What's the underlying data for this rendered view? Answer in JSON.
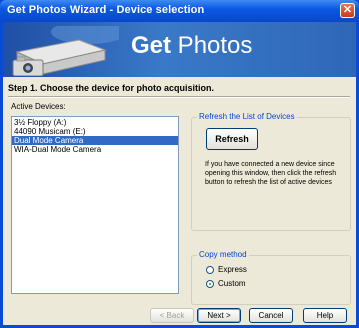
{
  "window": {
    "title": "Get Photos Wizard - Device selection",
    "close_glyph": "✕"
  },
  "banner": {
    "title_bold": "Get",
    "title_rest": " Photos",
    "logo_icon": "scanner-camera-icon"
  },
  "step": {
    "text": "Step 1. Choose the device for photo acquisition."
  },
  "devices": {
    "label": "Active Devices:",
    "items": [
      {
        "label": "3½ Floppy (A:)",
        "selected": false
      },
      {
        "label": "44090 Musicam (E:)",
        "selected": false
      },
      {
        "label": "Dual Mode Camera",
        "selected": true
      },
      {
        "label": "WIA-Dual Mode Camera",
        "selected": false
      }
    ]
  },
  "refresh": {
    "group_label": "Refresh the List of Devices",
    "button": "Refresh",
    "description": "If you have connected a new device since opening this window, then click the refresh button to refresh the list of active devices"
  },
  "copy_method": {
    "group_label": "Copy method",
    "options": [
      {
        "label": "Express",
        "checked": false
      },
      {
        "label": "Custom",
        "checked": true
      }
    ]
  },
  "footer": {
    "back": "< Back",
    "next": "Next >",
    "cancel": "Cancel",
    "help": "Help"
  }
}
